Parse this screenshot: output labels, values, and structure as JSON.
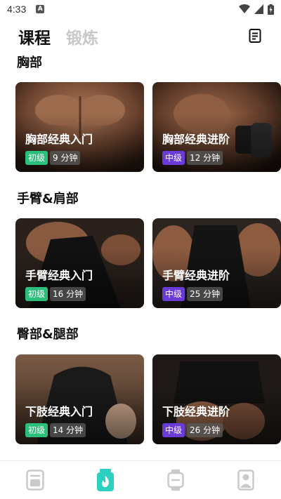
{
  "status_bar": {
    "time": "4:33",
    "notification_letter": "A"
  },
  "header": {
    "tab_active": "课程",
    "tab_inactive": "锻炼"
  },
  "colors": {
    "easy": "#2bbf7c",
    "mid": "#6a3bd6",
    "nav_active": "#2bd0c0",
    "nav_inactive": "#c9c9c9"
  },
  "sections": [
    {
      "title": "胸部",
      "cards": [
        {
          "title": "胸部经典入门",
          "level": "初级",
          "duration": "9 分钟"
        },
        {
          "title": "胸部经典进阶",
          "level": "中级",
          "duration": "12 分钟"
        }
      ]
    },
    {
      "title": "手臂&肩部",
      "cards": [
        {
          "title": "手臂经典入门",
          "level": "初级",
          "duration": "16 分钟"
        },
        {
          "title": "手臂经典进阶",
          "level": "中级",
          "duration": "25 分钟"
        }
      ]
    },
    {
      "title": "臀部&腿部",
      "cards": [
        {
          "title": "下肢经典入门",
          "level": "初级",
          "duration": "14 分钟"
        },
        {
          "title": "下肢经典进阶",
          "level": "中级",
          "duration": "26 分钟"
        }
      ]
    }
  ],
  "bottom_nav": [
    {
      "icon": "book-icon",
      "active": false
    },
    {
      "icon": "fire-bottle-icon",
      "active": true
    },
    {
      "icon": "watch-icon",
      "active": false
    },
    {
      "icon": "profile-icon",
      "active": false
    }
  ]
}
